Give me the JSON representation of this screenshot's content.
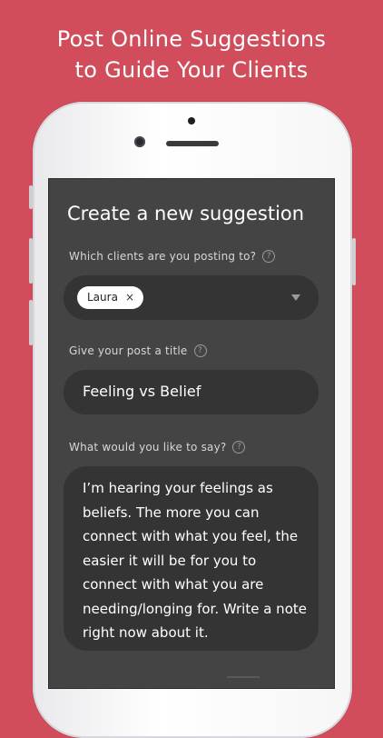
{
  "promo": {
    "headline_line1": "Post Online Suggestions",
    "headline_line2": "to Guide Your Clients"
  },
  "form": {
    "title": "Create a new suggestion",
    "clients": {
      "label": "Which clients are you posting to?",
      "selected": [
        "Laura"
      ],
      "remove_glyph": "×"
    },
    "post_title": {
      "label": "Give your post a title",
      "value": "Feeling vs Belief"
    },
    "message": {
      "label": "What would you like to say?",
      "value": "I’m hearing your feelings as beliefs. The more you can connect with what you feel, the easier it will be for you to connect with what you are needing/longing for. Write a note right now about it."
    },
    "help_glyph": "?"
  },
  "colors": {
    "background": "#d14d5b",
    "screen": "#444444",
    "field": "#343434",
    "text": "#ffffff"
  },
  "icons": {
    "help": "help-circle-icon",
    "dropdown": "chevron-down-icon",
    "remove": "close-icon"
  }
}
